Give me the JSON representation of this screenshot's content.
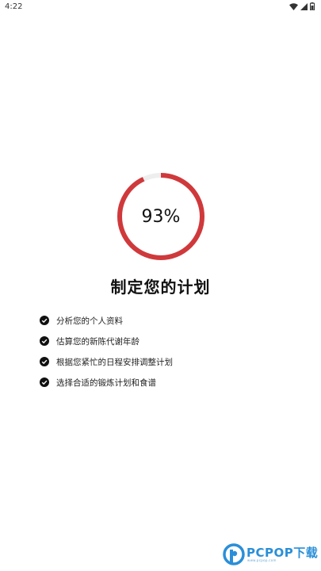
{
  "status_bar": {
    "time": "4:22",
    "icons": [
      "wifi-icon",
      "cell-signal-icon",
      "battery-icon"
    ]
  },
  "progress": {
    "value": 0.93,
    "label": "93%",
    "ring_color": "#d0393b",
    "track_color": "#eeeeee"
  },
  "title": "制定您的计划",
  "tasks": [
    {
      "label": "分析您的个人资料",
      "done": true
    },
    {
      "label": "估算您的新陈代谢年龄",
      "done": true
    },
    {
      "label": "根据您紧忙的日程安排调整计划",
      "done": true
    },
    {
      "label": "选择合适的锻炼计划和食谱",
      "done": true
    }
  ],
  "watermark": {
    "text": "PCPOP下载",
    "subtext": "www.pcpop.com",
    "color": "#2a8fd8"
  }
}
